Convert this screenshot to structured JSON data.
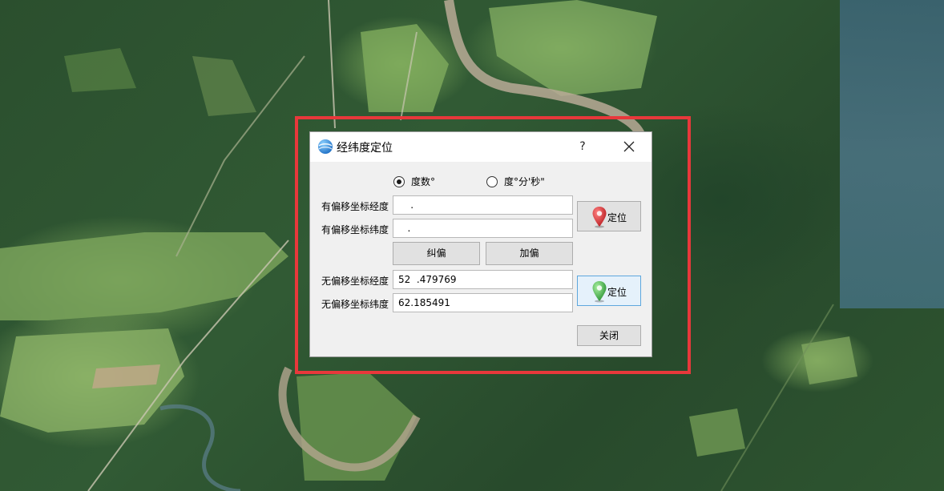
{
  "dialog": {
    "title": "经纬度定位",
    "help_label": "?",
    "format_options": [
      {
        "label": "度数°",
        "checked": true
      },
      {
        "label": "度°分'秒\"",
        "checked": false
      }
    ],
    "offset_lng_label": "有偏移坐标经度",
    "offset_lng_value": "    .",
    "offset_lat_label": "有偏移坐标纬度",
    "offset_lat_value": "   .",
    "correct_button": "纠偏",
    "add_offset_button": "加偏",
    "locate_offset_button": "定位",
    "plain_lng_label": "无偏移坐标经度",
    "plain_lng_value": "52  .479769",
    "plain_lat_label": "无偏移坐标纬度",
    "plain_lat_value": "62.185491",
    "locate_plain_button": "定位",
    "close_button": "关闭"
  },
  "colors": {
    "highlight": "#e8383b",
    "pin_red": "#d9262b",
    "pin_green": "#3aa640",
    "focus_border": "#5ea7dd"
  },
  "icons": [
    "globe-icon",
    "close-icon",
    "red-pin-icon",
    "green-pin-icon"
  ]
}
